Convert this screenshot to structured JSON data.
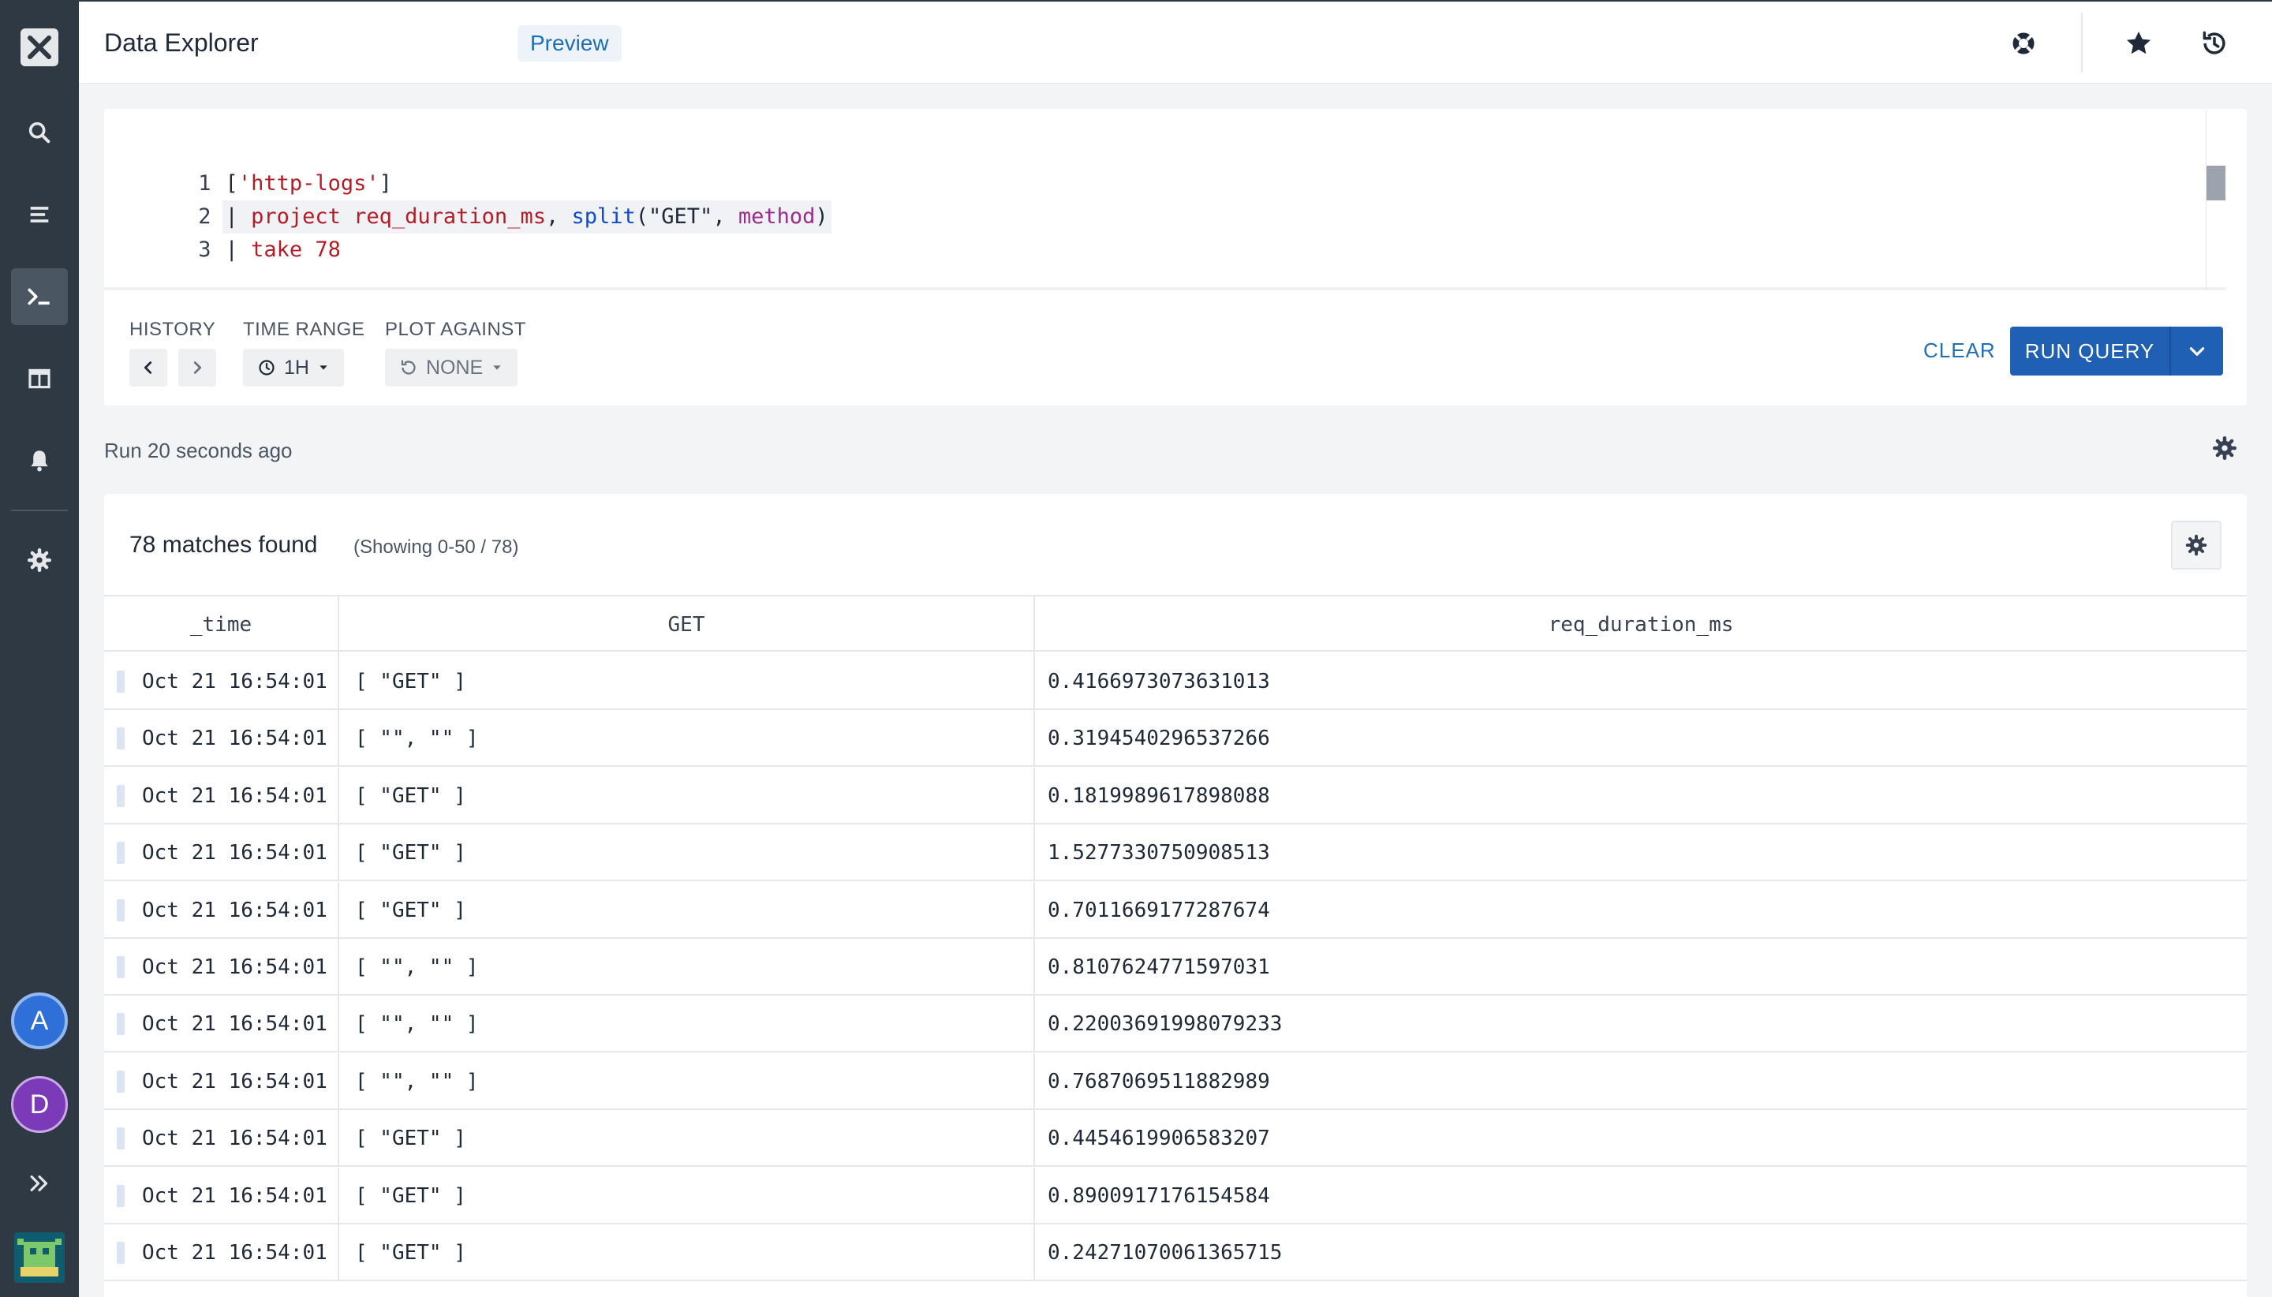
{
  "app": {
    "title": "Data Explorer",
    "badge": "Preview"
  },
  "sidebar": {
    "items": [
      {
        "icon": "search-icon"
      },
      {
        "icon": "stream-icon"
      },
      {
        "icon": "terminal-icon",
        "active": true
      },
      {
        "icon": "dashboard-icon"
      },
      {
        "icon": "bell-icon"
      },
      {
        "icon": "gear-icon"
      }
    ],
    "avatars": [
      {
        "initial": "A"
      },
      {
        "initial": "D"
      }
    ]
  },
  "editor": {
    "lines": [
      {
        "num": "1",
        "text": "['http-logs']"
      },
      {
        "num": "2",
        "text": "| project req_duration_ms, split(\"GET\", method)"
      },
      {
        "num": "3",
        "text": "| take 78"
      }
    ]
  },
  "controls": {
    "history_label": "HISTORY",
    "time_range_label": "TIME RANGE",
    "time_range_value": "1H",
    "plot_against_label": "PLOT AGAINST",
    "plot_against_value": "NONE",
    "clear_label": "CLEAR",
    "run_label": "RUN QUERY"
  },
  "run_info": "Run 20 seconds ago",
  "results": {
    "title": "78 matches found",
    "showing": "(Showing 0-50 / 78)",
    "columns": [
      "_time",
      "GET",
      "req_duration_ms"
    ],
    "rows": [
      {
        "time": "Oct 21 16:54:01",
        "get": "[ \"GET\" ]",
        "dur": "0.4166973073631013"
      },
      {
        "time": "Oct 21 16:54:01",
        "get": "[ \"\", \"\" ]",
        "dur": "0.3194540296537266"
      },
      {
        "time": "Oct 21 16:54:01",
        "get": "[ \"GET\" ]",
        "dur": "0.1819989617898088"
      },
      {
        "time": "Oct 21 16:54:01",
        "get": "[ \"GET\" ]",
        "dur": "1.5277330750908513"
      },
      {
        "time": "Oct 21 16:54:01",
        "get": "[ \"GET\" ]",
        "dur": "0.7011669177287674"
      },
      {
        "time": "Oct 21 16:54:01",
        "get": "[ \"\", \"\" ]",
        "dur": "0.8107624771597031"
      },
      {
        "time": "Oct 21 16:54:01",
        "get": "[ \"\", \"\" ]",
        "dur": "0.22003691998079233"
      },
      {
        "time": "Oct 21 16:54:01",
        "get": "[ \"\", \"\" ]",
        "dur": "0.7687069511882989"
      },
      {
        "time": "Oct 21 16:54:01",
        "get": "[ \"GET\" ]",
        "dur": "0.4454619906583207"
      },
      {
        "time": "Oct 21 16:54:01",
        "get": "[ \"GET\" ]",
        "dur": "0.8900917176154584"
      },
      {
        "time": "Oct 21 16:54:01",
        "get": "[ \"GET\" ]",
        "dur": "0.24271070061365715"
      }
    ]
  }
}
